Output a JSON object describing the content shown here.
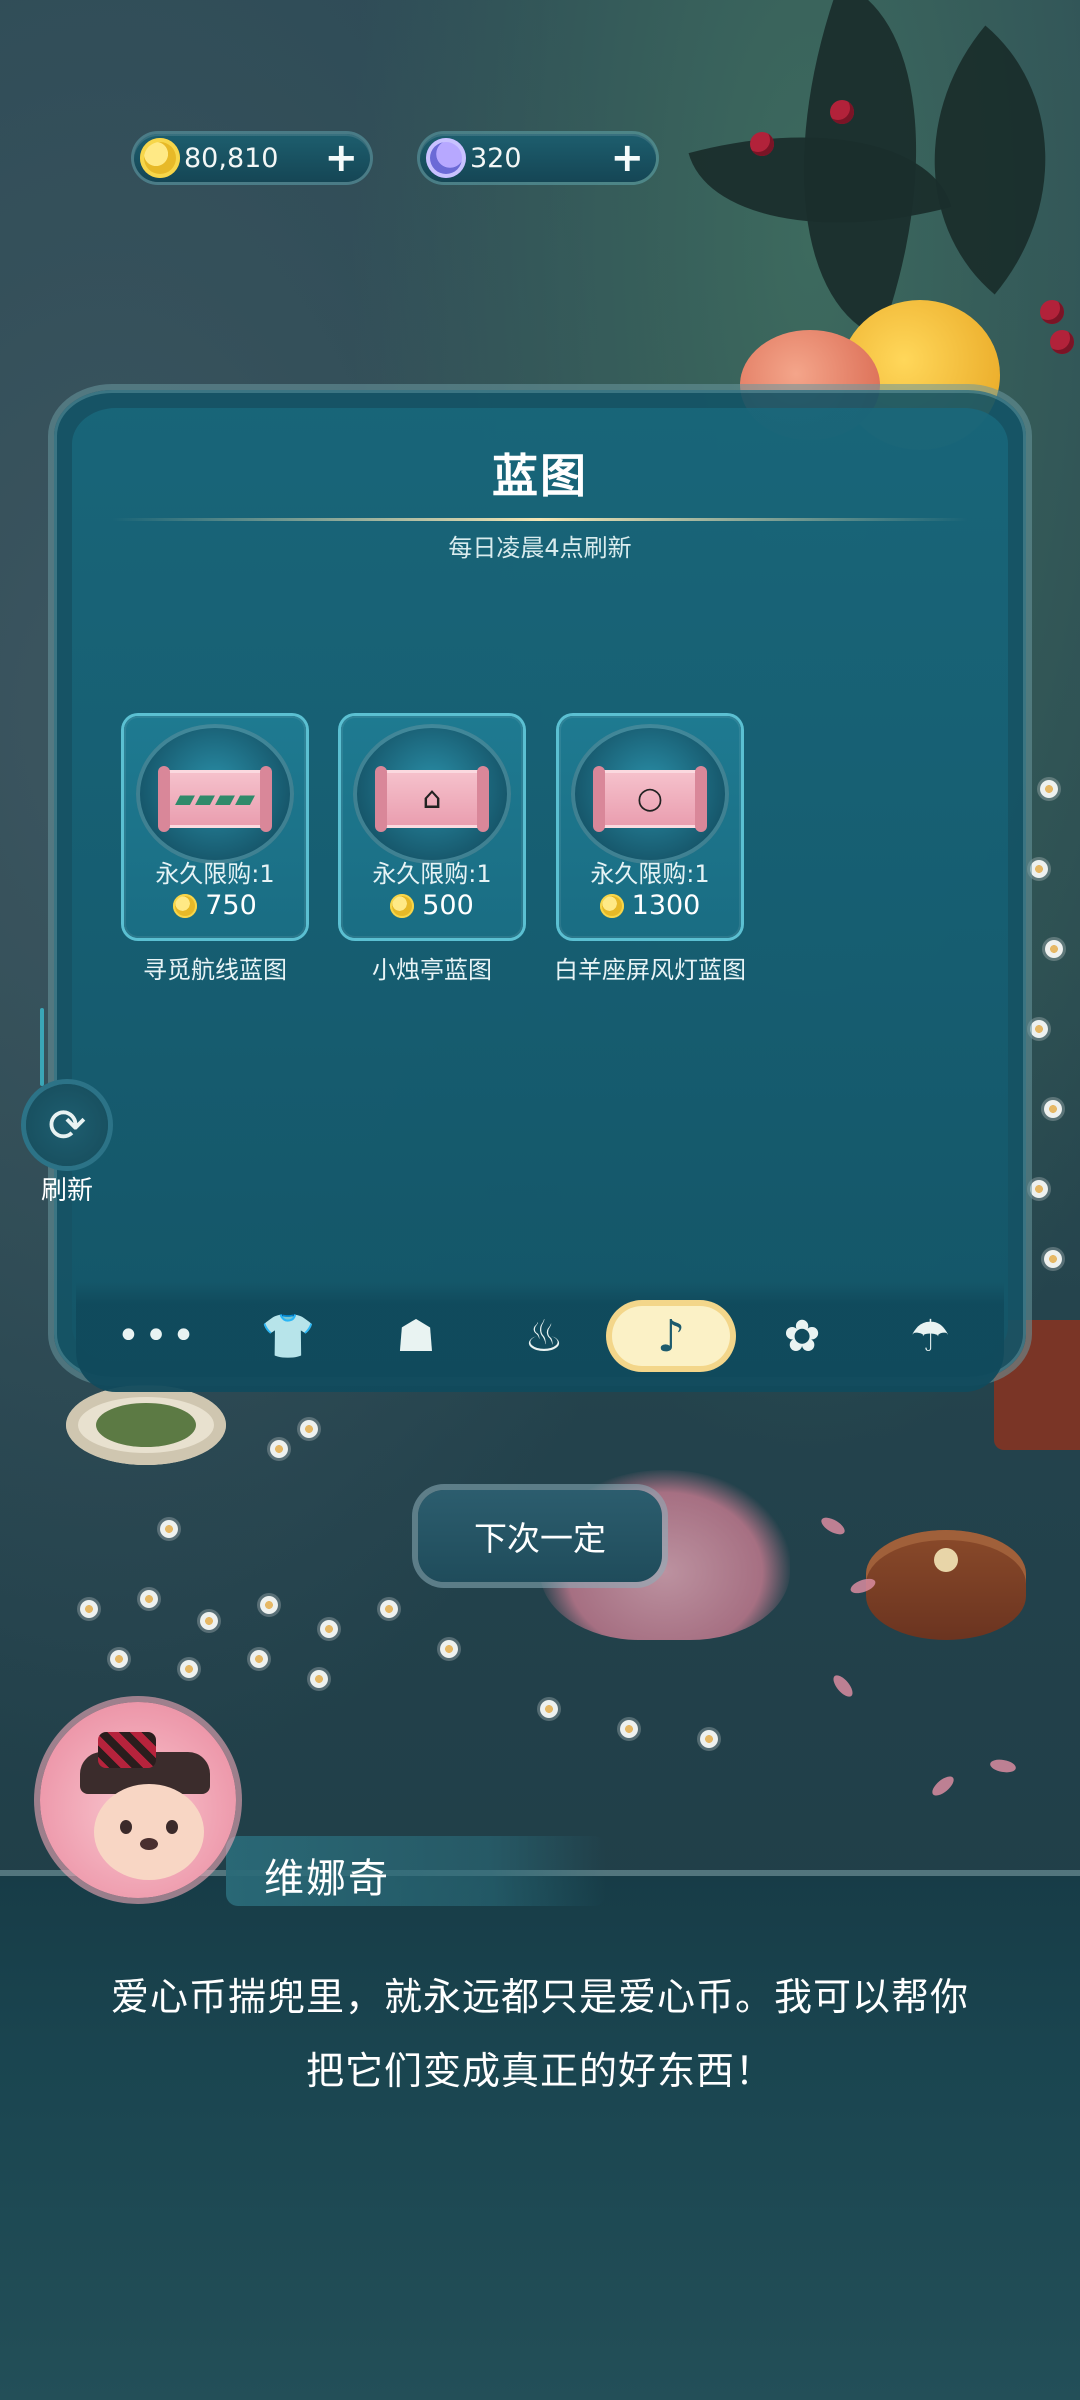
{
  "currency": {
    "coins": {
      "value": "80,810",
      "icon": "coin-icon",
      "plus": "+"
    },
    "moons": {
      "value": "320",
      "icon": "moon-icon",
      "plus": "+"
    }
  },
  "panel": {
    "title": "蓝图",
    "subtitle": "每日凌晨4点刷新",
    "cards": [
      {
        "limit": "永久限购:1",
        "price": "750",
        "name": "寻觅航线蓝图",
        "icon": "scroll-icon"
      },
      {
        "limit": "永久限购:1",
        "price": "500",
        "name": "小烛亭蓝图",
        "icon": "scroll-icon"
      },
      {
        "limit": "永久限购:1",
        "price": "1300",
        "name": "白羊座屏风灯蓝图",
        "icon": "scroll-icon"
      }
    ],
    "tabs": [
      {
        "icon": "more-icon",
        "glyph": "•••"
      },
      {
        "icon": "clothing-icon",
        "glyph": "👕"
      },
      {
        "icon": "furniture-icon",
        "glyph": "☗"
      },
      {
        "icon": "bag-icon",
        "glyph": "♨"
      },
      {
        "icon": "blueprint-tab-icon",
        "glyph": "♪"
      },
      {
        "icon": "flower-tab-icon",
        "glyph": "✿"
      },
      {
        "icon": "umbrella-icon",
        "glyph": "☂"
      }
    ],
    "active_tab_index": 4
  },
  "side": {
    "refresh_label": "刷新",
    "refresh_glyph": "⟳"
  },
  "next_button": {
    "label": "下次一定"
  },
  "dialogue": {
    "speaker": "维娜奇",
    "line1": "爱心币揣兜里，就永远都只是爱心币。我可以帮你",
    "line2": "把它们变成真正的好东西！"
  },
  "colors": {
    "panel": "#135466",
    "card": "#1e7a91",
    "active_tab": "#fbf1c6",
    "accent_line": "#f6e6b5"
  }
}
